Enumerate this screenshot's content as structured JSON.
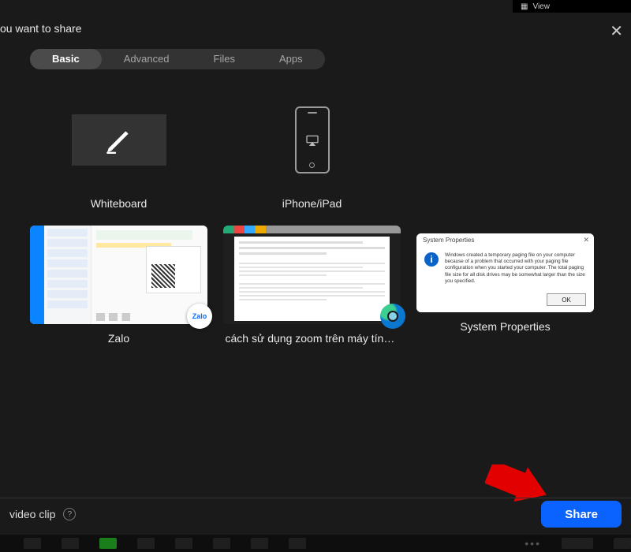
{
  "topstrip": {
    "label": "View"
  },
  "dialog": {
    "title_fragment": "ou want to share"
  },
  "tabs": [
    {
      "label": "Basic",
      "active": true
    },
    {
      "label": "Advanced",
      "active": false
    },
    {
      "label": "Files",
      "active": false
    },
    {
      "label": "Apps",
      "active": false
    }
  ],
  "cards": {
    "whiteboard": {
      "label": "Whiteboard"
    },
    "iphone": {
      "label": "iPhone/iPad"
    },
    "zalo": {
      "label": "Zalo",
      "badge_text": "Zalo"
    },
    "edge": {
      "label": "cách sử dụng zoom trên máy tính..."
    },
    "sysprops": {
      "label": "System Properties",
      "dialog_title": "System Properties",
      "body_text": "Windows created a temporary paging file on your computer because of a problem that occurred with your paging file configuration when you started your computer. The total paging file size for all disk drives may be somewhat larger than the size you specified.",
      "ok_label": "OK"
    }
  },
  "footer": {
    "left_text": "video clip",
    "share_label": "Share"
  }
}
